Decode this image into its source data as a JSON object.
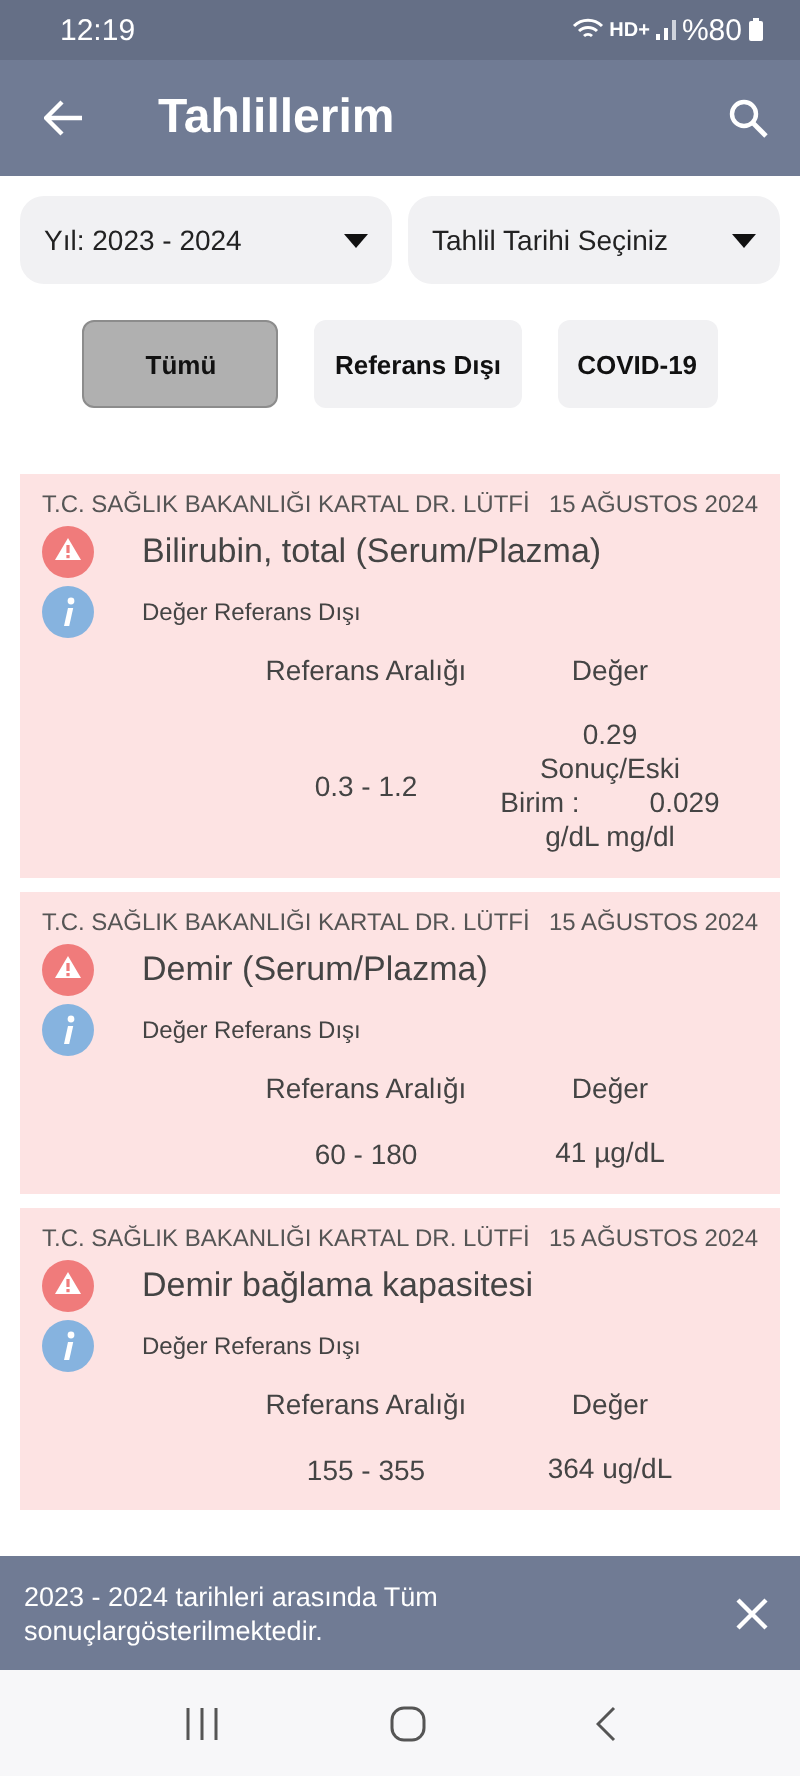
{
  "status_bar": {
    "time": "12:19",
    "network": "HD+",
    "battery": "%80"
  },
  "app_bar": {
    "title": "Tahlillerim"
  },
  "filters": [
    {
      "label": "Yıl: 2023 - 2024"
    },
    {
      "label": "Tahlil Tarihi Seçiniz"
    }
  ],
  "chips": [
    {
      "label": "Tümü",
      "selected": true
    },
    {
      "label": "Referans Dışı",
      "selected": false
    },
    {
      "label": "COVID-19",
      "selected": false
    }
  ],
  "results": [
    {
      "hospital": "T.C. SAĞLIK BAKANLIĞI KARTAL DR. LÜTFİ",
      "date": "15 AĞUSTOS 2024",
      "test": "Bilirubin, total (Serum/Plazma)",
      "status": "Değer Referans Dışı",
      "range_label": "Referans Aralığı",
      "value_label": "Değer",
      "range": "0.3 - 1.2",
      "value_lines": [
        "0.29",
        "Sonuç/Eski",
        "Birim :         0.029",
        "g/dL mg/dl"
      ]
    },
    {
      "hospital": "T.C. SAĞLIK BAKANLIĞI KARTAL DR. LÜTFİ",
      "date": "15 AĞUSTOS 2024",
      "test": "Demir (Serum/Plazma)",
      "status": "Değer Referans Dışı",
      "range_label": "Referans Aralığı",
      "value_label": "Değer",
      "range": "60 - 180",
      "value_lines": [
        "41 µg/dL"
      ]
    },
    {
      "hospital": "T.C. SAĞLIK BAKANLIĞI KARTAL DR. LÜTFİ",
      "date": "15 AĞUSTOS 2024",
      "test": "Demir bağlama kapasitesi",
      "status": "Değer Referans Dışı",
      "range_label": "Referans Aralığı",
      "value_label": "Değer",
      "range": "155 - 355",
      "value_lines": [
        "364 ug/dL"
      ]
    }
  ],
  "snackbar": {
    "message": "2023 - 2024 tarihleri arasında Tüm sonuçlargösterilmektedir."
  }
}
